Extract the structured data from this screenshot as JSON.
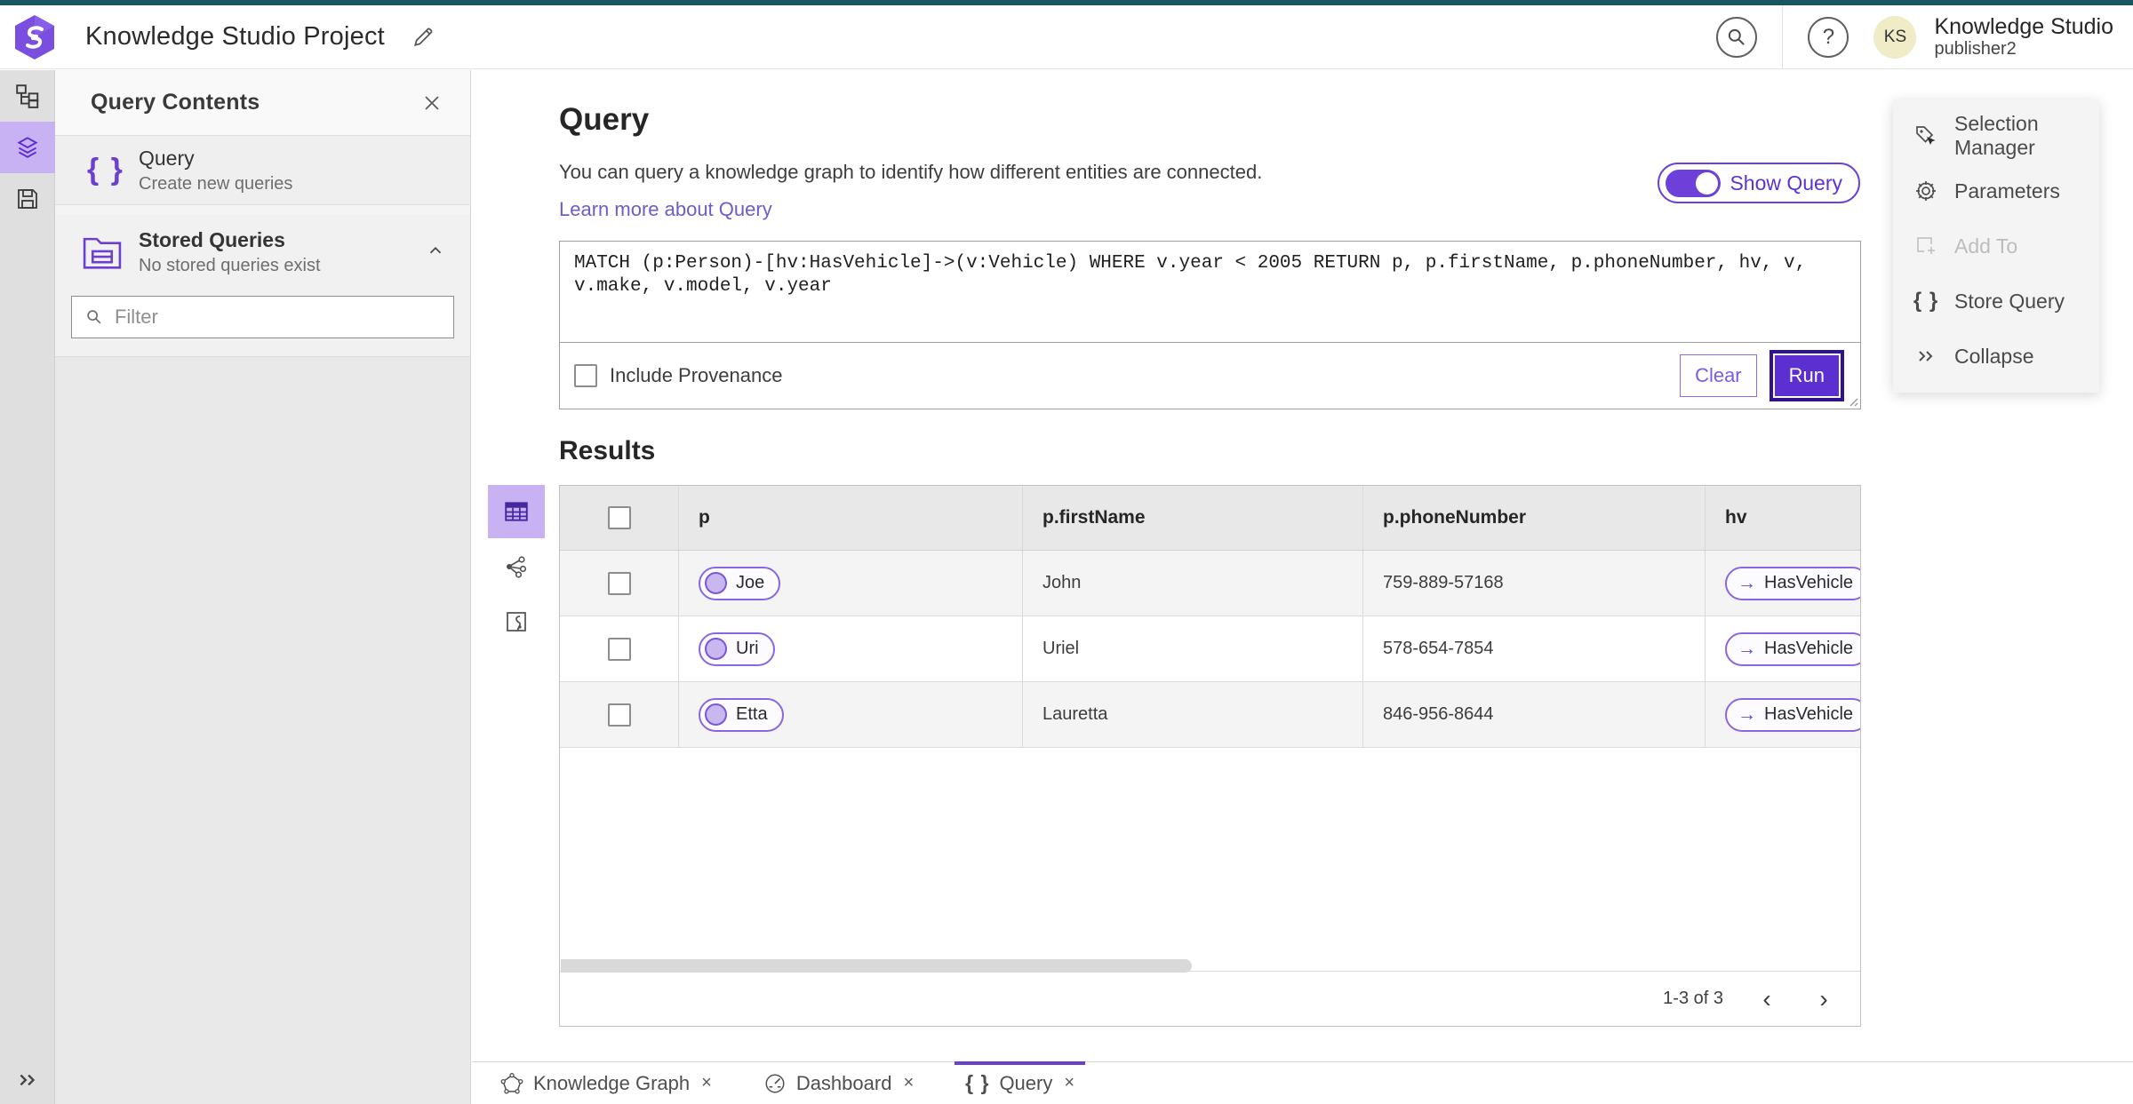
{
  "app": {
    "window_title": "Knowledge Studio Project",
    "product_name": "Knowledge Studio",
    "user_name": "publisher2",
    "avatar_initials": "KS",
    "help_glyph": "?"
  },
  "left_rail": {
    "items": [
      {
        "icon": "hierarchy-icon",
        "selected": false
      },
      {
        "icon": "layers-icon",
        "selected": true
      },
      {
        "icon": "save-icon",
        "selected": false
      }
    ],
    "expand_icon": "double-chevron-right-icon"
  },
  "query_contents_panel": {
    "title": "Query Contents",
    "close_icon": "close-icon",
    "query_item": {
      "icon": "braces-icon",
      "braces": "{ }",
      "title": "Query",
      "subtitle": "Create new queries"
    },
    "stored_queries": {
      "icon": "folder-icon",
      "title": "Stored Queries",
      "subtitle": "No stored queries exist",
      "collapse_icon": "chevron-up-icon"
    },
    "filter": {
      "icon": "search-icon",
      "placeholder": "Filter"
    }
  },
  "query_section": {
    "title": "Query",
    "description": "You can query a knowledge graph to identify how different entities are connected.",
    "learn_more_link": "Learn more about Query",
    "show_query_label": "Show Query",
    "show_query_on": true,
    "query_text": "MATCH (p:Person)-[hv:HasVehicle]->(v:Vehicle) WHERE v.year < 2005 RETURN p, p.firstName, p.phoneNumber, hv, v, v.make, v.model, v.year",
    "include_provenance_label": "Include Provenance",
    "include_provenance_checked": false,
    "clear_label": "Clear",
    "run_label": "Run"
  },
  "results": {
    "title": "Results",
    "view_icons": [
      "table-icon",
      "graph-icon",
      "map-icon"
    ],
    "columns": {
      "c1": "p",
      "c2": "p.firstName",
      "c3": "p.phoneNumber",
      "c4": "hv"
    },
    "rows": [
      {
        "p": "Joe",
        "firstName": "John",
        "phoneNumber": "759-889-57168",
        "hv": "HasVehicle",
        "hv_arrow": "→"
      },
      {
        "p": "Uri",
        "firstName": "Uriel",
        "phoneNumber": "578-654-7854",
        "hv": "HasVehicle",
        "hv_arrow": "→"
      },
      {
        "p": "Etta",
        "firstName": "Lauretta",
        "phoneNumber": "846-956-8644",
        "hv": "HasVehicle",
        "hv_arrow": "→"
      }
    ],
    "pagination": {
      "range_text": "1-3 of 3",
      "prev_glyph": "‹",
      "next_glyph": "›"
    }
  },
  "tools_panel": {
    "items": [
      {
        "label": "Selection Manager",
        "icon": "tag-cursor-icon",
        "disabled": false
      },
      {
        "label": "Parameters",
        "icon": "gear-icon",
        "disabled": false
      },
      {
        "label": "Add To",
        "icon": "add-to-icon",
        "disabled": true
      },
      {
        "label": "Store Query",
        "icon": "braces-icon",
        "braces": "{ }",
        "disabled": false
      },
      {
        "label": "Collapse",
        "icon": "double-chevron-right-icon",
        "disabled": false
      }
    ]
  },
  "tabs": [
    {
      "label": "Knowledge Graph",
      "icon": "knowledge-graph-icon",
      "close": "×",
      "active": false
    },
    {
      "label": "Dashboard",
      "icon": "dashboard-icon",
      "close": "×",
      "active": false
    },
    {
      "label": "Query",
      "icon": "braces-icon",
      "braces": "{ }",
      "close": "×",
      "active": true
    }
  ],
  "colors": {
    "accent_purple": "#6d41d9",
    "run_button": "#5b2fd0",
    "run_focus_ring": "#31128f",
    "selected_rail_bg": "#c9b2f4",
    "link_purple": "#6d5cc9",
    "top_strip_teal": "#19555e",
    "avatar_bg": "#f0ecc8",
    "pill_border": "#8a66e3",
    "pill_node_fill": "#c9b8f0"
  }
}
